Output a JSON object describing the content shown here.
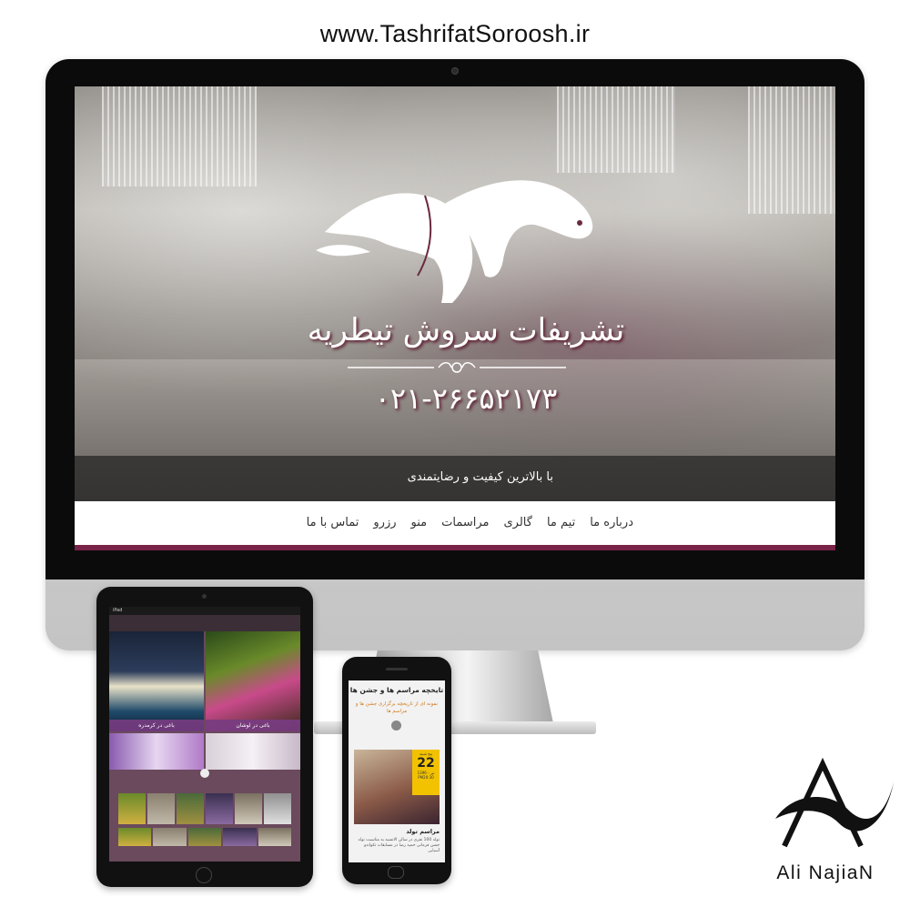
{
  "site_url": "www.TashrifatSoroosh.ir",
  "desktop": {
    "hero_title": "تشریفات سروش تیطریه",
    "phone": "۰۲۱-۲۶۶۵۲۱۷۳",
    "tagline": "با بالاترین کیفیت و رضایتمندی",
    "nav": [
      "درباره ما",
      "تیم ما",
      "گالری",
      "مراسمات",
      "منو",
      "رزرو",
      "تماس با ما"
    ]
  },
  "tablet": {
    "status": "iPad",
    "tiles": [
      {
        "caption": "باغی در کرمدره"
      },
      {
        "caption": "باغی در لوشان"
      }
    ]
  },
  "mobile": {
    "title": "تایخچه مراسم ها و جشن ها",
    "subtitle": "نمونه ای از تاریخچه برگزاری جشن ها و مراسم ها",
    "date_weekday": "پنج شنبه",
    "date_day": "22",
    "date_month_year": "تیر - 1396",
    "date_time": "PM20:30",
    "event_title": "مراسم تولد",
    "event_body": "تولد 100 نفری در سالن الانسیه به مناسبت تولد جشن فرمانی حمید رضا در مسابقات تکواندو آسیایی"
  },
  "author": "Ali NajiaN",
  "colors": {
    "accent": "#7a2248",
    "hero_bar": "#232323",
    "tile_caption": "#78418a",
    "date_badge": "#f2c200",
    "subtitle": "#d07a1a"
  }
}
